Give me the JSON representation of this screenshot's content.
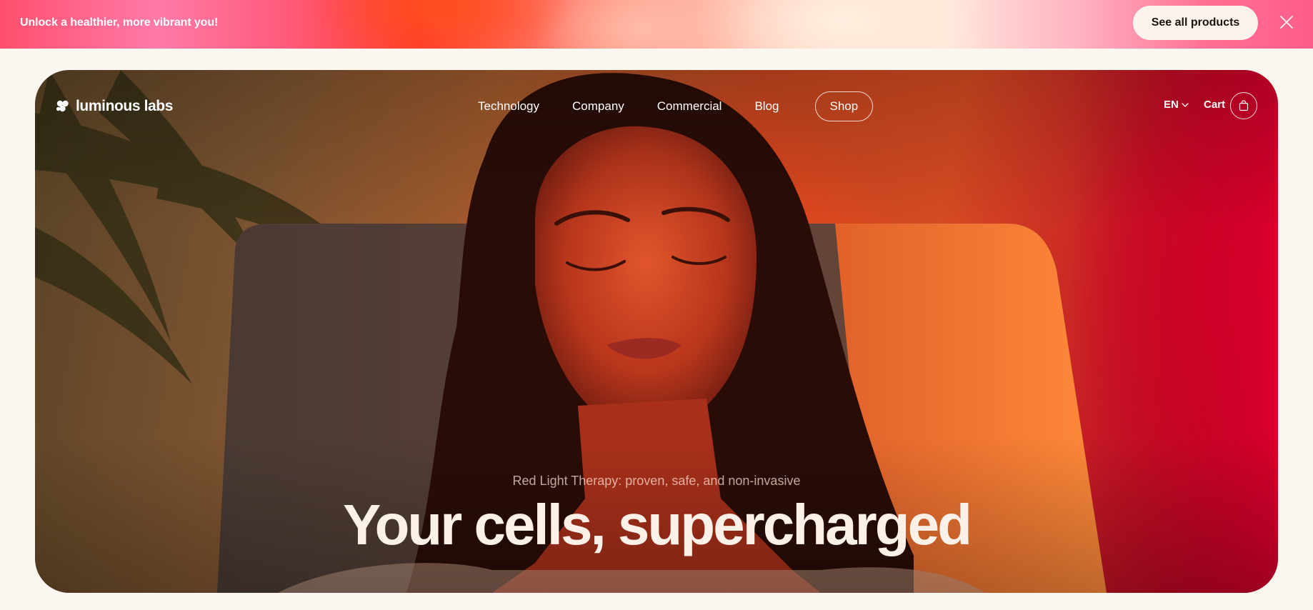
{
  "announcement": {
    "text": "Unlock a healthier, more vibrant you!",
    "cta_label": "See all products",
    "close_icon": "close-icon"
  },
  "header": {
    "logo_text": "luminous labs",
    "logo_icon": "cluster-dots-icon",
    "nav": [
      {
        "label": "Technology"
      },
      {
        "label": "Company"
      },
      {
        "label": "Commercial"
      },
      {
        "label": "Blog"
      }
    ],
    "shop_label": "Shop",
    "language": "EN",
    "language_icon": "chevron-down-icon",
    "cart_label": "Cart",
    "cart_icon": "shopping-bag-icon"
  },
  "hero": {
    "eyebrow": "Red Light Therapy: proven, safe, and non-invasive",
    "headline": "Your cells, supercharged"
  },
  "colors": {
    "page_background": "#fbf6f0",
    "announcement_gradient": [
      "#ff4f6d",
      "#ff3b2a",
      "#ffe8db",
      "#ff5d8a"
    ],
    "cta_background": "#fbf4ec",
    "hero_red": "#c61a26",
    "text_light": "#ffffff"
  }
}
